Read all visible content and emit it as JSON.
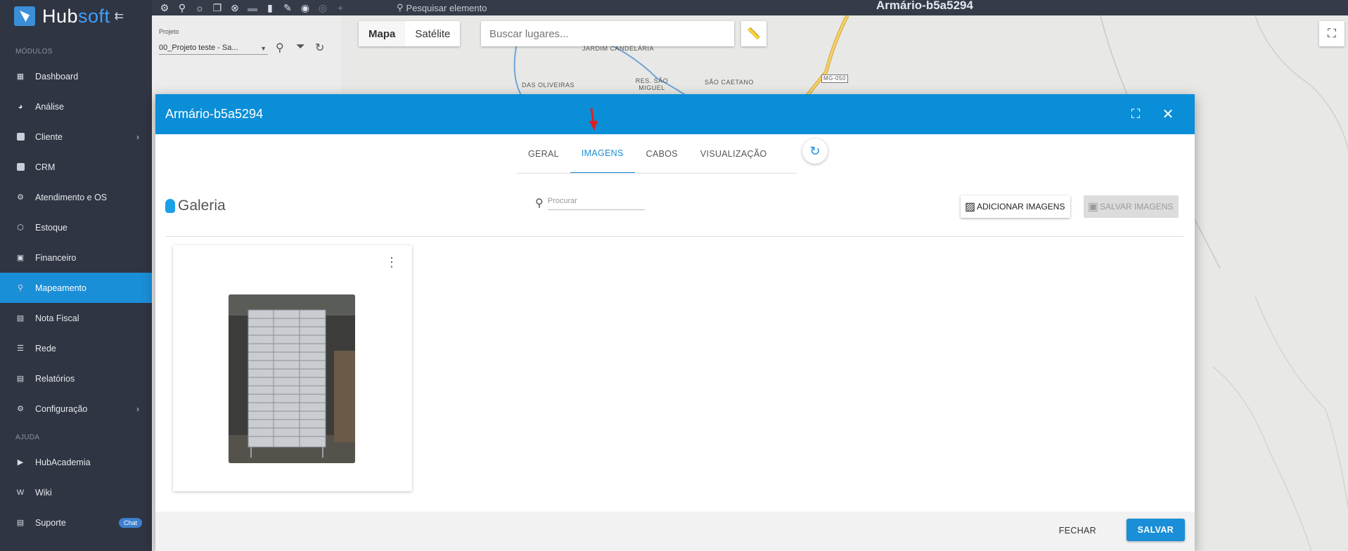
{
  "brand": {
    "name_a": "Hub",
    "name_b": "soft",
    "collapse_icon": "collapse-arrow-icon"
  },
  "sidebar": {
    "section_modules": "MÓDULOS",
    "section_help": "AJUDA",
    "items": [
      {
        "label": "Dashboard",
        "icon": "dashboard-icon"
      },
      {
        "label": "Análise",
        "icon": "pie-chart-icon"
      },
      {
        "label": "Cliente",
        "icon": "contact-card-icon",
        "chevron": "›"
      },
      {
        "label": "CRM",
        "icon": "crm-icon"
      },
      {
        "label": "Atendimento e OS",
        "icon": "service-icon"
      },
      {
        "label": "Estoque",
        "icon": "box-icon"
      },
      {
        "label": "Financeiro",
        "icon": "money-icon"
      },
      {
        "label": "Mapeamento",
        "icon": "map-pin-icon",
        "active": true
      },
      {
        "label": "Nota Fiscal",
        "icon": "invoice-icon"
      },
      {
        "label": "Rede",
        "icon": "network-icon"
      },
      {
        "label": "Relatórios",
        "icon": "report-icon"
      },
      {
        "label": "Configuração",
        "icon": "gear-icon",
        "chevron": "›"
      }
    ],
    "help_items": [
      {
        "label": "HubAcademia",
        "icon": "play-icon"
      },
      {
        "label": "Wiki",
        "icon": "wiki-icon"
      },
      {
        "label": "Suporte",
        "icon": "support-icon",
        "badge": "Chat"
      }
    ]
  },
  "topbar": {
    "search_placeholder": "Pesquisar elemento",
    "title": "Armário-b5a5294"
  },
  "project": {
    "label": "Projeto",
    "value": "00_Projeto teste - Sa..."
  },
  "map": {
    "btn_map": "Mapa",
    "btn_satellite": "Satélite",
    "search_placeholder": "Buscar lugares...",
    "labels": [
      "JARDIM CANDELÁRIA",
      "DAS OLIVEIRAS",
      "RES. SÃO MIGUEL",
      "SÃO CAETANO",
      "MG-050"
    ]
  },
  "modal": {
    "title": "Armário-b5a5294",
    "tabs": [
      "GERAL",
      "IMAGENS",
      "CABOS",
      "VISUALIZAÇÃO"
    ],
    "active_tab": "IMAGENS",
    "gallery_title": "Galeria",
    "search_placeholder": "Procurar",
    "add_images": "ADICIONAR IMAGENS",
    "save_images": "SALVAR IMAGENS",
    "close": "FECHAR",
    "save": "SALVAR"
  },
  "colors": {
    "sidebar_bg": "#2f3542",
    "accent": "#1a8ed6",
    "modal_header": "#0b8ed8"
  }
}
